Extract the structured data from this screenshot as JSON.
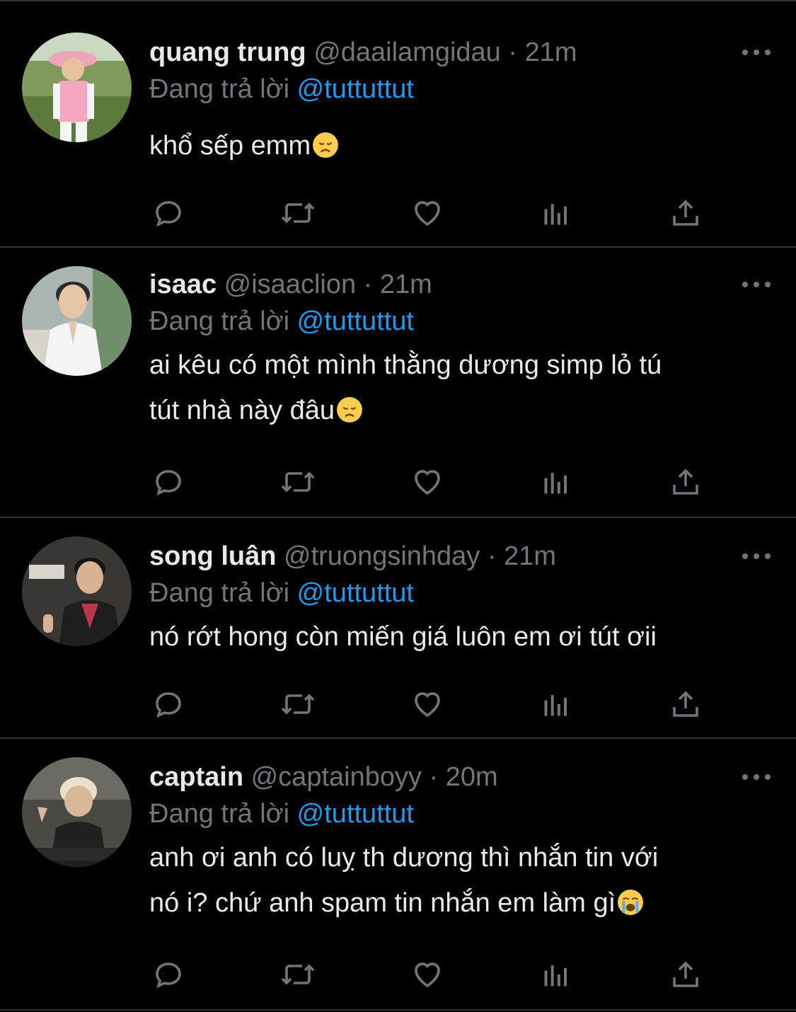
{
  "tweets": [
    {
      "name": "quang trung",
      "handle": "@daailamgidau",
      "time": "21m",
      "separator": " · ",
      "reply_prefix": "Đang trả lời ",
      "reply_to": "@tuttuttut",
      "text": "khổ sếp emm",
      "emoji": "disappointed-face"
    },
    {
      "name": "isaac",
      "handle": "@isaaclion",
      "time": "21m",
      "separator": " · ",
      "reply_prefix": "Đang trả lời ",
      "reply_to": "@tuttuttut",
      "text_line1": "ai kêu có một mình thằng dương simp lỏ tú",
      "text_line2": "tút nhà này đâu",
      "emoji": "disappointed-face"
    },
    {
      "name": "song luân",
      "handle": "@truongsinhday",
      "time": "21m",
      "separator": " · ",
      "reply_prefix": "Đang trả lời ",
      "reply_to": "@tuttuttut",
      "text": "nó rớt hong còn miến giá luôn em ơi tút ơii"
    },
    {
      "name": "captain",
      "handle": "@captainboyy",
      "time": "20m",
      "separator": " · ",
      "reply_prefix": "Đang trả lời ",
      "reply_to": "@tuttuttut",
      "text_line1": "anh ơi anh có luỵ th dương thì nhắn tin với",
      "text_line2": "nó i? chứ anh spam tin nhắn em làm gì",
      "emoji": "loudly-crying-face"
    }
  ],
  "action_icons": [
    "reply-icon",
    "retweet-icon",
    "like-icon",
    "views-icon",
    "share-icon"
  ],
  "colors": {
    "background": "#000000",
    "text": "#e7e9ea",
    "muted": "#71767b",
    "link": "#1d9bf0",
    "divider": "#2f3336"
  }
}
